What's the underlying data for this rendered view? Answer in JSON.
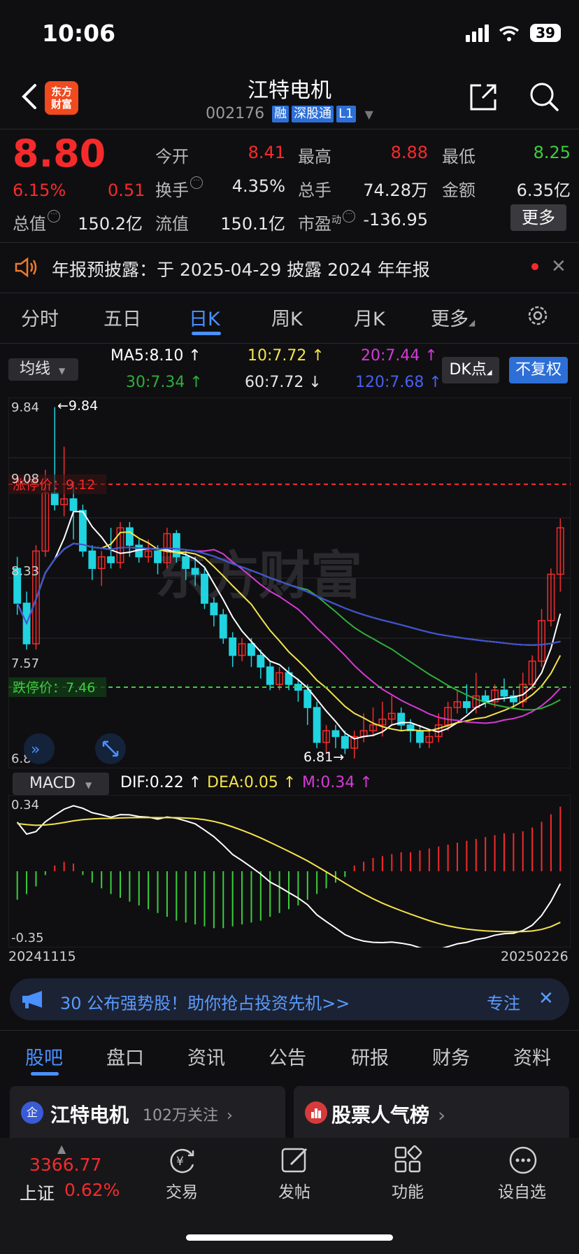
{
  "status_bar": {
    "time": "10:06",
    "battery": "39"
  },
  "header": {
    "stock_name": "江特电机",
    "stock_code": "002176",
    "tags": [
      "融",
      "深股通",
      "L1"
    ],
    "logo_text_1": "东方",
    "logo_text_2": "财富"
  },
  "quote": {
    "price": "8.80",
    "change_pct": "6.15%",
    "change_amt": "0.51",
    "open_label": "今开",
    "open": "8.41",
    "high_label": "最高",
    "high": "8.88",
    "low_label": "最低",
    "low": "8.25",
    "turnover_label": "换手",
    "turnover": "4.35%",
    "volume_label": "总手",
    "volume": "74.28万",
    "amount_label": "金额",
    "amount": "6.35亿",
    "mktcap_label": "总值",
    "mktcap": "150.2亿",
    "float_label": "流值",
    "float": "150.1亿",
    "pe_label": "市盈",
    "pe_sup": "动",
    "pe": "-136.95",
    "more_label": "更多"
  },
  "announcement": {
    "text": "年报预披露：于 2025-04-29 披露 2024 年年报"
  },
  "chart_tabs": [
    "分时",
    "五日",
    "日K",
    "周K",
    "月K",
    "更多"
  ],
  "ma_row": {
    "select_label": "均线",
    "ma5": "MA5:8.10 ↑",
    "ma10": "10:7.72 ↑",
    "ma20": "20:7.44 ↑",
    "ma30": "30:7.34 ↑",
    "ma60": "60:7.72 ↓",
    "ma120": "120:7.68 ↑",
    "dk_label": "DK点",
    "fq_label": "不复权"
  },
  "colors": {
    "up": "#f52b2b",
    "down": "#1fd4e0",
    "ma5": "#ffffff",
    "ma10": "#f5e34a",
    "ma20": "#d63ad6",
    "ma30": "#2fae3a",
    "ma60": "#d8d8d8",
    "ma120": "#3a4fd6",
    "accent": "#4a90ff"
  },
  "kchart_labels": {
    "y_top": "9.84",
    "y_mid1": "9.08",
    "y_mid2": "8.33",
    "y_mid3": "7.57",
    "y_bottom": "6.81",
    "high_mark": "←9.84",
    "low_mark": "6.81→",
    "limit_up": "涨停价：9.12",
    "limit_down": "跌停价：7.46"
  },
  "macd": {
    "select_label": "MACD",
    "dif": "DIF:0.22 ↑",
    "dea": "DEA:0.05 ↑",
    "m": "M:0.34 ↑",
    "y_top": "0.34",
    "y_bottom": "-0.35"
  },
  "chart_data": {
    "type": "candlestick",
    "x_start": "20241115",
    "x_end": "20250226",
    "ylim": [
      6.81,
      9.84
    ],
    "candles": [
      [
        8.45,
        8.15,
        8.55,
        8.05
      ],
      [
        8.15,
        7.8,
        8.25,
        7.75
      ],
      [
        7.8,
        8.6,
        8.65,
        7.75
      ],
      [
        8.6,
        9.1,
        9.3,
        8.55
      ],
      [
        9.1,
        9.0,
        9.84,
        8.95
      ],
      [
        9.0,
        9.05,
        9.5,
        8.9
      ],
      [
        9.05,
        8.95,
        9.2,
        8.7
      ],
      [
        8.95,
        8.6,
        9.0,
        8.55
      ],
      [
        8.6,
        8.45,
        8.65,
        8.35
      ],
      [
        8.45,
        8.55,
        8.6,
        8.3
      ],
      [
        8.55,
        8.5,
        8.8,
        8.45
      ],
      [
        8.5,
        8.8,
        8.85,
        8.45
      ],
      [
        8.8,
        8.65,
        8.85,
        8.55
      ],
      [
        8.65,
        8.55,
        8.7,
        8.5
      ],
      [
        8.55,
        8.6,
        8.7,
        8.5
      ],
      [
        8.6,
        8.5,
        8.65,
        8.4
      ],
      [
        8.5,
        8.75,
        8.8,
        8.45
      ],
      [
        8.75,
        8.55,
        8.78,
        8.5
      ],
      [
        8.55,
        8.45,
        8.6,
        8.35
      ],
      [
        8.45,
        8.4,
        8.55,
        8.3
      ],
      [
        8.4,
        8.15,
        8.45,
        8.1
      ],
      [
        8.15,
        8.05,
        8.2,
        7.95
      ],
      [
        8.05,
        7.85,
        8.1,
        7.8
      ],
      [
        7.85,
        7.7,
        7.9,
        7.6
      ],
      [
        7.7,
        7.8,
        7.85,
        7.65
      ],
      [
        7.8,
        7.7,
        7.85,
        7.6
      ],
      [
        7.7,
        7.6,
        7.75,
        7.5
      ],
      [
        7.6,
        7.45,
        7.65,
        7.4
      ],
      [
        7.45,
        7.55,
        7.6,
        7.4
      ],
      [
        7.55,
        7.45,
        7.6,
        7.4
      ],
      [
        7.45,
        7.4,
        7.5,
        7.3
      ],
      [
        7.4,
        7.25,
        7.45,
        7.1
      ],
      [
        7.25,
        6.95,
        7.3,
        6.9
      ],
      [
        6.95,
        7.05,
        7.1,
        6.85
      ],
      [
        7.05,
        7.0,
        7.1,
        6.9
      ],
      [
        7.0,
        6.9,
        7.05,
        6.85
      ],
      [
        6.9,
        7.0,
        7.05,
        6.81
      ],
      [
        7.0,
        7.05,
        7.2,
        6.95
      ],
      [
        7.05,
        7.1,
        7.25,
        7.0
      ],
      [
        7.1,
        7.15,
        7.3,
        7.0
      ],
      [
        7.15,
        7.2,
        7.35,
        7.1
      ],
      [
        7.2,
        7.1,
        7.25,
        7.05
      ],
      [
        7.1,
        7.05,
        7.15,
        6.95
      ],
      [
        7.05,
        6.95,
        7.1,
        6.9
      ],
      [
        6.95,
        7.0,
        7.05,
        6.9
      ],
      [
        7.0,
        7.1,
        7.2,
        6.95
      ],
      [
        7.1,
        7.25,
        7.3,
        7.05
      ],
      [
        7.25,
        7.3,
        7.4,
        7.2
      ],
      [
        7.3,
        7.25,
        7.45,
        7.2
      ],
      [
        7.25,
        7.35,
        7.55,
        7.2
      ],
      [
        7.35,
        7.3,
        7.4,
        7.25
      ],
      [
        7.3,
        7.4,
        7.45,
        7.25
      ],
      [
        7.4,
        7.35,
        7.5,
        7.3
      ],
      [
        7.35,
        7.3,
        7.4,
        7.25
      ],
      [
        7.3,
        7.45,
        7.55,
        7.25
      ],
      [
        7.45,
        7.65,
        7.7,
        7.4
      ],
      [
        7.65,
        8.0,
        8.1,
        7.6
      ],
      [
        8.0,
        8.4,
        8.45,
        7.95
      ],
      [
        8.4,
        8.8,
        8.88,
        8.25
      ]
    ],
    "macd_hist": [
      -0.15,
      -0.12,
      -0.08,
      -0.02,
      0.03,
      0.05,
      0.04,
      -0.02,
      -0.06,
      -0.09,
      -0.12,
      -0.14,
      -0.16,
      -0.18,
      -0.2,
      -0.22,
      -0.24,
      -0.26,
      -0.27,
      -0.28,
      -0.29,
      -0.3,
      -0.3,
      -0.29,
      -0.28,
      -0.27,
      -0.26,
      -0.24,
      -0.22,
      -0.2,
      -0.18,
      -0.15,
      -0.12,
      -0.09,
      -0.06,
      -0.03,
      0.03,
      0.05,
      0.07,
      0.08,
      0.09,
      0.1,
      0.1,
      0.11,
      0.12,
      0.13,
      0.14,
      0.15,
      0.16,
      0.17,
      0.18,
      0.19,
      0.2,
      0.2,
      0.21,
      0.23,
      0.26,
      0.3,
      0.34
    ]
  },
  "promo": {
    "text": "30 公布强势股！助你抢占投资先机>>",
    "follow": "专注"
  },
  "bottom_tabs": [
    "股吧",
    "盘口",
    "资讯",
    "公告",
    "研报",
    "财务",
    "资料"
  ],
  "cards": {
    "left_title": "江特电机",
    "left_sub": "102万关注",
    "right_title": "股票人气榜"
  },
  "bottom_nav": {
    "index_value": "3366.77",
    "index_name": "上证",
    "index_pct": "0.62%",
    "items": [
      "交易",
      "发帖",
      "功能",
      "设自选"
    ]
  }
}
